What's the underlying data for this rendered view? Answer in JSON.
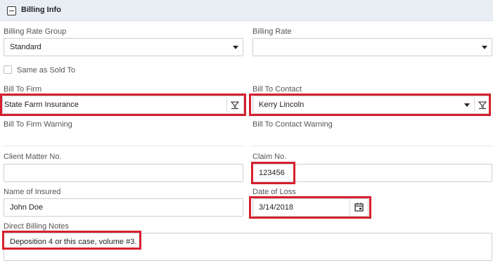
{
  "section": {
    "title": "Billing Info"
  },
  "billing_rate_group": {
    "label": "Billing Rate Group",
    "value": "Standard"
  },
  "billing_rate": {
    "label": "Billing Rate",
    "value": ""
  },
  "same_as_sold_to": {
    "label": "Same as Sold To",
    "checked": false
  },
  "bill_to_firm": {
    "label": "Bill To Firm",
    "value": "State Farm Insurance"
  },
  "bill_to_contact": {
    "label": "Bill To Contact",
    "value": "Kerry Lincoln"
  },
  "bill_to_firm_warning": {
    "label": "Bill To Firm Warning"
  },
  "bill_to_contact_warning": {
    "label": "Bill To Contact Warning"
  },
  "client_matter_no": {
    "label": "Client Matter No.",
    "value": ""
  },
  "claim_no": {
    "label": "Claim No.",
    "value": "123456"
  },
  "name_of_insured": {
    "label": "Name of Insured",
    "value": "John Doe"
  },
  "date_of_loss": {
    "label": "Date of Loss",
    "value": "3/14/2018"
  },
  "direct_billing_notes": {
    "label": "Direct Billing Notes",
    "value": "Deposition 4 or this case, volume #3."
  },
  "colors": {
    "highlight": "#d6202d",
    "header_bg": "#e9eef5"
  }
}
